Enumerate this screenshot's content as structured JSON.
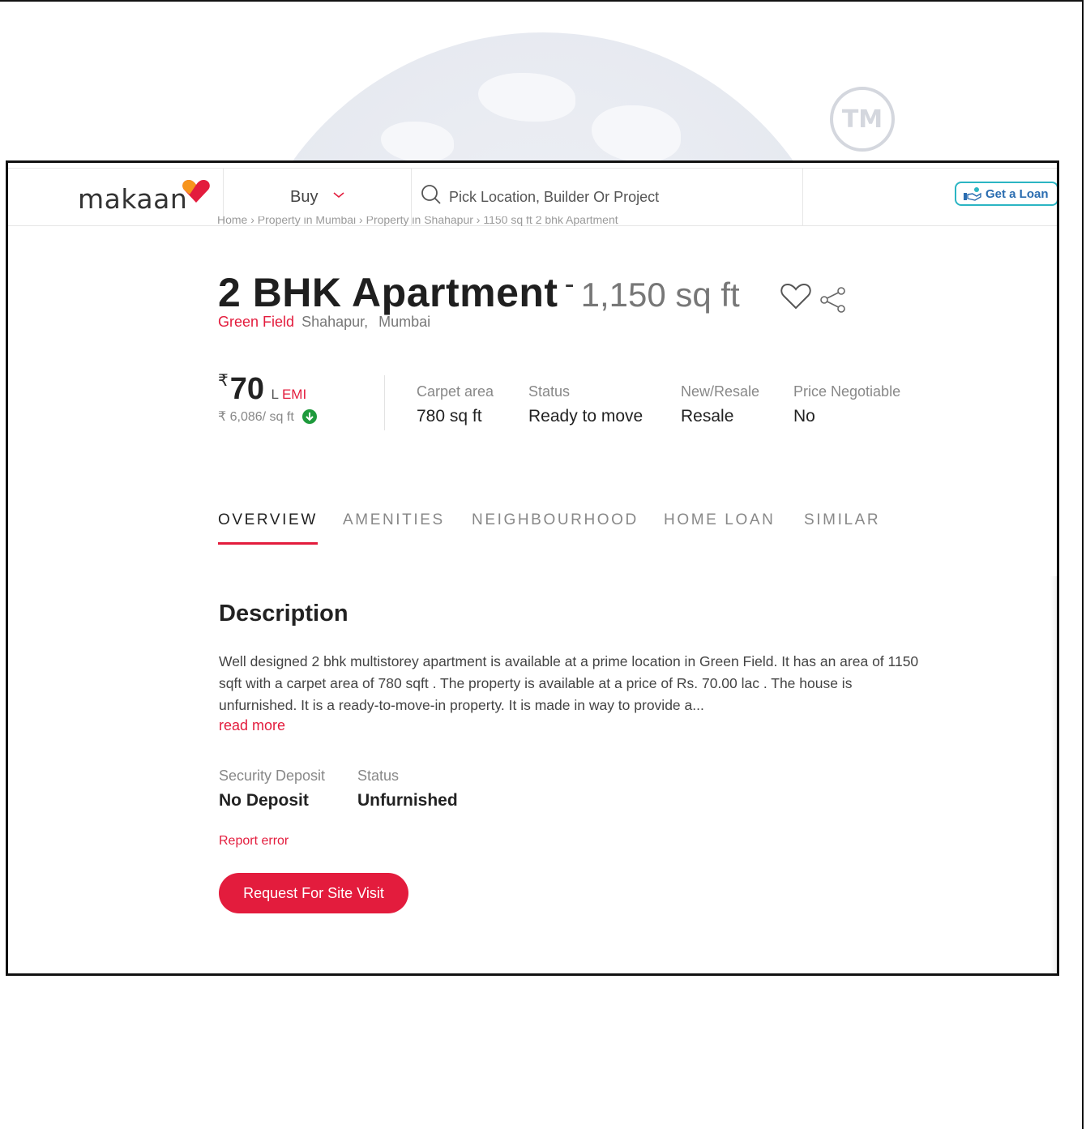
{
  "watermark": {
    "seal_text": "TM"
  },
  "header": {
    "logo_text": "makaan",
    "buy_label": "Buy",
    "search_placeholder": "Pick Location, Builder Or Project",
    "loan_label": "Get a Loan"
  },
  "breadcrumb": {
    "text": "Home  ›  Property in Mumbai  ›  Property in Shahapur  ›  1150 sq ft 2 bhk Apartment"
  },
  "listing": {
    "title": "2 BHK Apartment",
    "separator": "-",
    "size": "1,150 sq ft",
    "project": "Green Field",
    "area": "Shahapur,",
    "city": "Mumbai",
    "price_symbol": "₹",
    "price": "70",
    "price_unit": "L",
    "emi_label": "EMI",
    "price_per_sqft": "₹ 6,086/ sq ft"
  },
  "specs": [
    {
      "label": "Carpet area",
      "value": "780 sq ft"
    },
    {
      "label": "Status",
      "value": "Ready to move"
    },
    {
      "label": "New/Resale",
      "value": "Resale"
    },
    {
      "label": "Price Negotiable",
      "value": "No"
    }
  ],
  "tabs": [
    "OVERVIEW",
    "AMENITIES",
    "NEIGHBOURHOOD",
    "HOME LOAN",
    "SIMILAR"
  ],
  "description": {
    "title": "Description",
    "text": "Well designed 2 bhk multistorey apartment is available at a prime location in Green Field. It has an area of 1150 sqft with a carpet area of 780 sqft . The property is available at a price of Rs. 70.00 lac . The house is unfurnished. It is a ready-to-move-in property. It is made in way to provide a...",
    "read_more": "read more"
  },
  "extra_specs": [
    {
      "label": "Security Deposit",
      "value": "No Deposit"
    },
    {
      "label": "Status",
      "value": "Unfurnished"
    }
  ],
  "actions": {
    "report_error": "Report error",
    "site_visit": "Request For Site Visit"
  },
  "colors": {
    "accent": "#e31c3d",
    "loan_border": "#2bb5c3",
    "loan_text": "#2a6cb0",
    "down_arrow": "#1e9a3c"
  }
}
